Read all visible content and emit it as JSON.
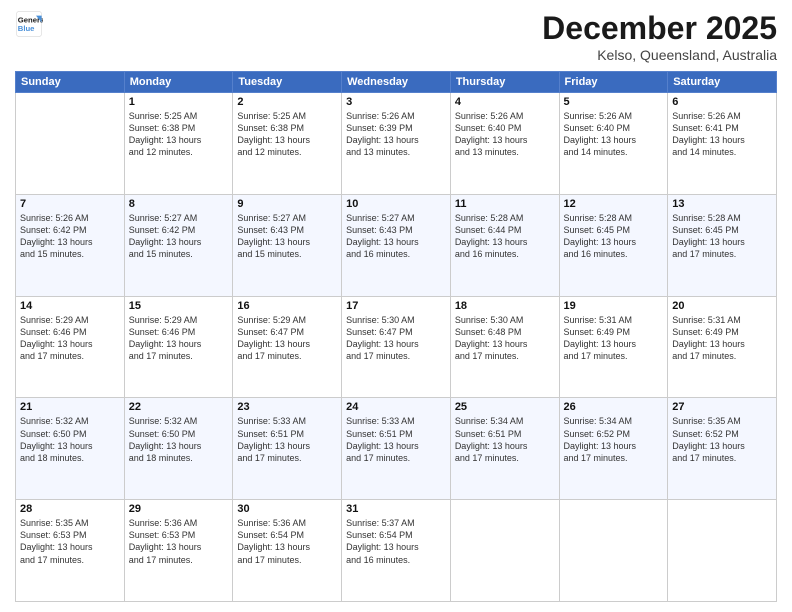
{
  "header": {
    "logo_line1": "General",
    "logo_line2": "Blue",
    "month": "December 2025",
    "location": "Kelso, Queensland, Australia"
  },
  "days_of_week": [
    "Sunday",
    "Monday",
    "Tuesday",
    "Wednesday",
    "Thursday",
    "Friday",
    "Saturday"
  ],
  "weeks": [
    [
      {
        "day": "",
        "info": ""
      },
      {
        "day": "1",
        "info": "Sunrise: 5:25 AM\nSunset: 6:38 PM\nDaylight: 13 hours\nand 12 minutes."
      },
      {
        "day": "2",
        "info": "Sunrise: 5:25 AM\nSunset: 6:38 PM\nDaylight: 13 hours\nand 12 minutes."
      },
      {
        "day": "3",
        "info": "Sunrise: 5:26 AM\nSunset: 6:39 PM\nDaylight: 13 hours\nand 13 minutes."
      },
      {
        "day": "4",
        "info": "Sunrise: 5:26 AM\nSunset: 6:40 PM\nDaylight: 13 hours\nand 13 minutes."
      },
      {
        "day": "5",
        "info": "Sunrise: 5:26 AM\nSunset: 6:40 PM\nDaylight: 13 hours\nand 14 minutes."
      },
      {
        "day": "6",
        "info": "Sunrise: 5:26 AM\nSunset: 6:41 PM\nDaylight: 13 hours\nand 14 minutes."
      }
    ],
    [
      {
        "day": "7",
        "info": "Sunrise: 5:26 AM\nSunset: 6:42 PM\nDaylight: 13 hours\nand 15 minutes."
      },
      {
        "day": "8",
        "info": "Sunrise: 5:27 AM\nSunset: 6:42 PM\nDaylight: 13 hours\nand 15 minutes."
      },
      {
        "day": "9",
        "info": "Sunrise: 5:27 AM\nSunset: 6:43 PM\nDaylight: 13 hours\nand 15 minutes."
      },
      {
        "day": "10",
        "info": "Sunrise: 5:27 AM\nSunset: 6:43 PM\nDaylight: 13 hours\nand 16 minutes."
      },
      {
        "day": "11",
        "info": "Sunrise: 5:28 AM\nSunset: 6:44 PM\nDaylight: 13 hours\nand 16 minutes."
      },
      {
        "day": "12",
        "info": "Sunrise: 5:28 AM\nSunset: 6:45 PM\nDaylight: 13 hours\nand 16 minutes."
      },
      {
        "day": "13",
        "info": "Sunrise: 5:28 AM\nSunset: 6:45 PM\nDaylight: 13 hours\nand 17 minutes."
      }
    ],
    [
      {
        "day": "14",
        "info": "Sunrise: 5:29 AM\nSunset: 6:46 PM\nDaylight: 13 hours\nand 17 minutes."
      },
      {
        "day": "15",
        "info": "Sunrise: 5:29 AM\nSunset: 6:46 PM\nDaylight: 13 hours\nand 17 minutes."
      },
      {
        "day": "16",
        "info": "Sunrise: 5:29 AM\nSunset: 6:47 PM\nDaylight: 13 hours\nand 17 minutes."
      },
      {
        "day": "17",
        "info": "Sunrise: 5:30 AM\nSunset: 6:47 PM\nDaylight: 13 hours\nand 17 minutes."
      },
      {
        "day": "18",
        "info": "Sunrise: 5:30 AM\nSunset: 6:48 PM\nDaylight: 13 hours\nand 17 minutes."
      },
      {
        "day": "19",
        "info": "Sunrise: 5:31 AM\nSunset: 6:49 PM\nDaylight: 13 hours\nand 17 minutes."
      },
      {
        "day": "20",
        "info": "Sunrise: 5:31 AM\nSunset: 6:49 PM\nDaylight: 13 hours\nand 17 minutes."
      }
    ],
    [
      {
        "day": "21",
        "info": "Sunrise: 5:32 AM\nSunset: 6:50 PM\nDaylight: 13 hours\nand 18 minutes."
      },
      {
        "day": "22",
        "info": "Sunrise: 5:32 AM\nSunset: 6:50 PM\nDaylight: 13 hours\nand 18 minutes."
      },
      {
        "day": "23",
        "info": "Sunrise: 5:33 AM\nSunset: 6:51 PM\nDaylight: 13 hours\nand 17 minutes."
      },
      {
        "day": "24",
        "info": "Sunrise: 5:33 AM\nSunset: 6:51 PM\nDaylight: 13 hours\nand 17 minutes."
      },
      {
        "day": "25",
        "info": "Sunrise: 5:34 AM\nSunset: 6:51 PM\nDaylight: 13 hours\nand 17 minutes."
      },
      {
        "day": "26",
        "info": "Sunrise: 5:34 AM\nSunset: 6:52 PM\nDaylight: 13 hours\nand 17 minutes."
      },
      {
        "day": "27",
        "info": "Sunrise: 5:35 AM\nSunset: 6:52 PM\nDaylight: 13 hours\nand 17 minutes."
      }
    ],
    [
      {
        "day": "28",
        "info": "Sunrise: 5:35 AM\nSunset: 6:53 PM\nDaylight: 13 hours\nand 17 minutes."
      },
      {
        "day": "29",
        "info": "Sunrise: 5:36 AM\nSunset: 6:53 PM\nDaylight: 13 hours\nand 17 minutes."
      },
      {
        "day": "30",
        "info": "Sunrise: 5:36 AM\nSunset: 6:54 PM\nDaylight: 13 hours\nand 17 minutes."
      },
      {
        "day": "31",
        "info": "Sunrise: 5:37 AM\nSunset: 6:54 PM\nDaylight: 13 hours\nand 16 minutes."
      },
      {
        "day": "",
        "info": ""
      },
      {
        "day": "",
        "info": ""
      },
      {
        "day": "",
        "info": ""
      }
    ]
  ]
}
